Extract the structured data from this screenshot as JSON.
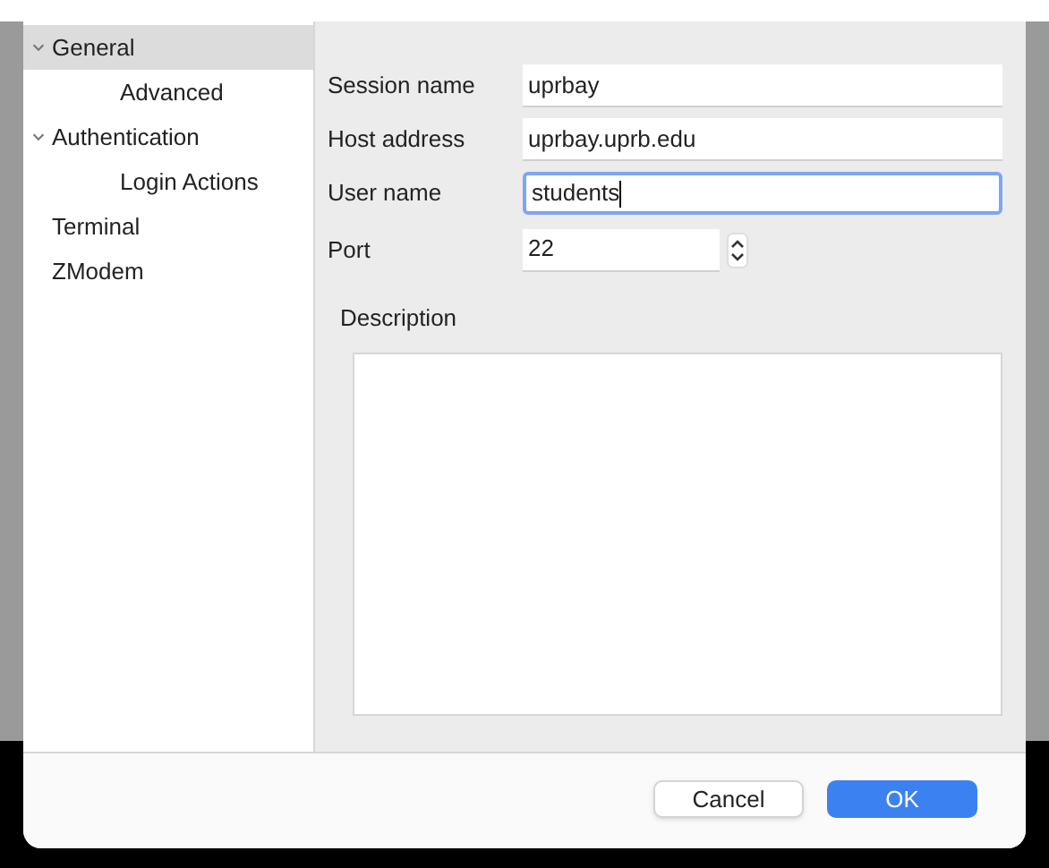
{
  "sidebar": {
    "items": [
      {
        "label": "General",
        "expanded": true,
        "selected": true,
        "children": [
          {
            "label": "Advanced",
            "selected": false
          }
        ]
      },
      {
        "label": "Authentication",
        "expanded": true,
        "selected": false,
        "children": [
          {
            "label": "Login Actions",
            "selected": false
          }
        ]
      },
      {
        "label": "Terminal",
        "selected": false
      },
      {
        "label": "ZModem",
        "selected": false
      }
    ]
  },
  "form": {
    "fields": [
      {
        "label": "Session name",
        "value": "uprbay",
        "focused": false
      },
      {
        "label": "Host address",
        "value": "uprbay.uprb.edu",
        "focused": false
      },
      {
        "label": "User name",
        "value": "students",
        "focused": true
      }
    ],
    "port": {
      "label": "Port",
      "value": "22"
    },
    "description": {
      "label": "Description"
    }
  },
  "buttons": [
    {
      "label": "Cancel",
      "kind": "secondary"
    },
    {
      "label": "OK",
      "kind": "primary"
    }
  ]
}
